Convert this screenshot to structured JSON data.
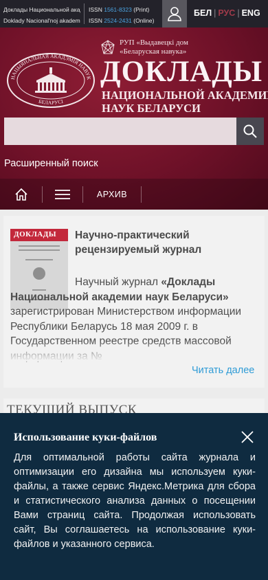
{
  "topbar": {
    "journal_ru": "Доклады Национальной академии наук Беларуси",
    "journal_translit": "Doklady Nacional'noj akademii nauk Belarusi",
    "issn_label": "ISSN",
    "issn_print": "1561-8323",
    "issn_print_suffix": "(Print)",
    "issn_online": "2524-2431",
    "issn_online_suffix": "(Online)",
    "languages": [
      "БЕЛ",
      "РУС",
      "ENG"
    ],
    "active_language": "РУС",
    "user_icon": "user-icon"
  },
  "header": {
    "publisher_line1": "РУП «Выдавецкі дом",
    "publisher_line2": "«Беларуская навука»",
    "emblem_top": "НАЦЫЯНАЛЬНАЯ АКАДЭМІЯ НАВУК",
    "emblem_bottom": "БЕЛАРУСІ",
    "title": "ДОКЛАДЫ",
    "subtitle_line1": "НАЦИОНАЛЬНОЙ АКАДЕМИИ",
    "subtitle_line2": "НАУК БЕЛАРУСИ",
    "search_placeholder": "",
    "advanced_search": "Расширенный поиск",
    "nav_archive": "АРХИВ",
    "accent": "#7a1530"
  },
  "journal": {
    "cover_title": "ДОКЛАДЫ",
    "kind": "Научно-практический рецензируемый журнал",
    "body_start": "Научный журнал ",
    "body_bold": "«Доклады Национальной академии наук Беларуси»",
    "body_rest": " зарегистрирован Министерством информации Республики Беларусь 18 мая 2009 г. в Государственном реестре средств массовой информации за №",
    "read_more": "Читать далее"
  },
  "current_issue": {
    "heading": "ТЕКУЩИЙ ВЫПУСК"
  },
  "cookie": {
    "title": "Использование куки-файлов",
    "text": "Для оптимальной работы сайта журнала и оптимизации его дизайна мы используем куки-файлы, а также сервис Яндекс.Метрика для сбора и статистического анализа данных о посещении Вами страниц сайта. Продолжая использовать сайт, Вы соглашаетесь на использование куки-файлов и указанного сервиса.",
    "close_icon": "close-icon",
    "background": "#0f2b40"
  }
}
